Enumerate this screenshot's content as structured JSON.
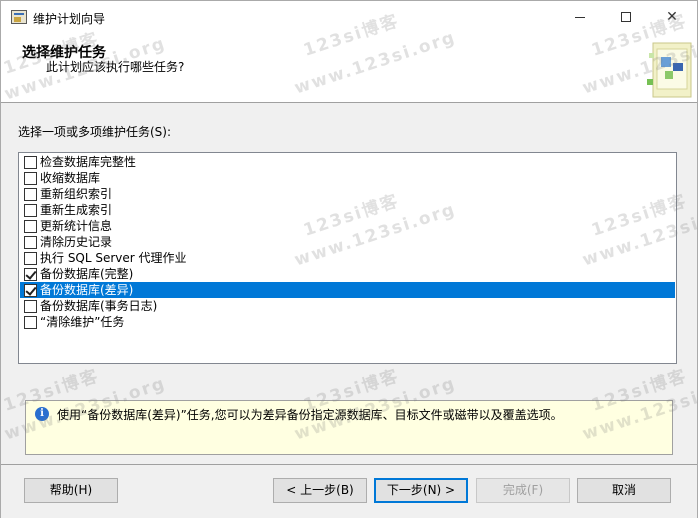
{
  "window": {
    "title": "维护计划向导",
    "minimize": "—",
    "maximize": "□",
    "close": "✕"
  },
  "header": {
    "title": "选择维护任务",
    "subtitle": "此计划应该执行哪些任务?"
  },
  "main": {
    "list_label": "选择一项或多项维护任务(S):",
    "tasks": [
      {
        "label": "检查数据库完整性",
        "checked": false,
        "selected": false
      },
      {
        "label": "收缩数据库",
        "checked": false,
        "selected": false
      },
      {
        "label": "重新组织索引",
        "checked": false,
        "selected": false
      },
      {
        "label": "重新生成索引",
        "checked": false,
        "selected": false
      },
      {
        "label": "更新统计信息",
        "checked": false,
        "selected": false
      },
      {
        "label": "清除历史记录",
        "checked": false,
        "selected": false
      },
      {
        "label": "执行 SQL Server 代理作业",
        "checked": false,
        "selected": false
      },
      {
        "label": "备份数据库(完整)",
        "checked": true,
        "selected": false
      },
      {
        "label": "备份数据库(差异)",
        "checked": true,
        "selected": true
      },
      {
        "label": "备份数据库(事务日志)",
        "checked": false,
        "selected": false
      },
      {
        "label": "“清除维护”任务",
        "checked": false,
        "selected": false
      }
    ],
    "info_text": "使用“备份数据库(差异)”任务,您可以为差异备份指定源数据库、目标文件或磁带以及覆盖选项。"
  },
  "footer": {
    "help": "帮助(H)",
    "back": "< 上一步(B)",
    "next": "下一步(N) >",
    "finish": "完成(F)",
    "cancel": "取消"
  },
  "watermark": {
    "cn": "123si博客",
    "url": "www.123si.org"
  },
  "colors": {
    "selection": "#0078d7",
    "info_background": "#ffffe1"
  }
}
